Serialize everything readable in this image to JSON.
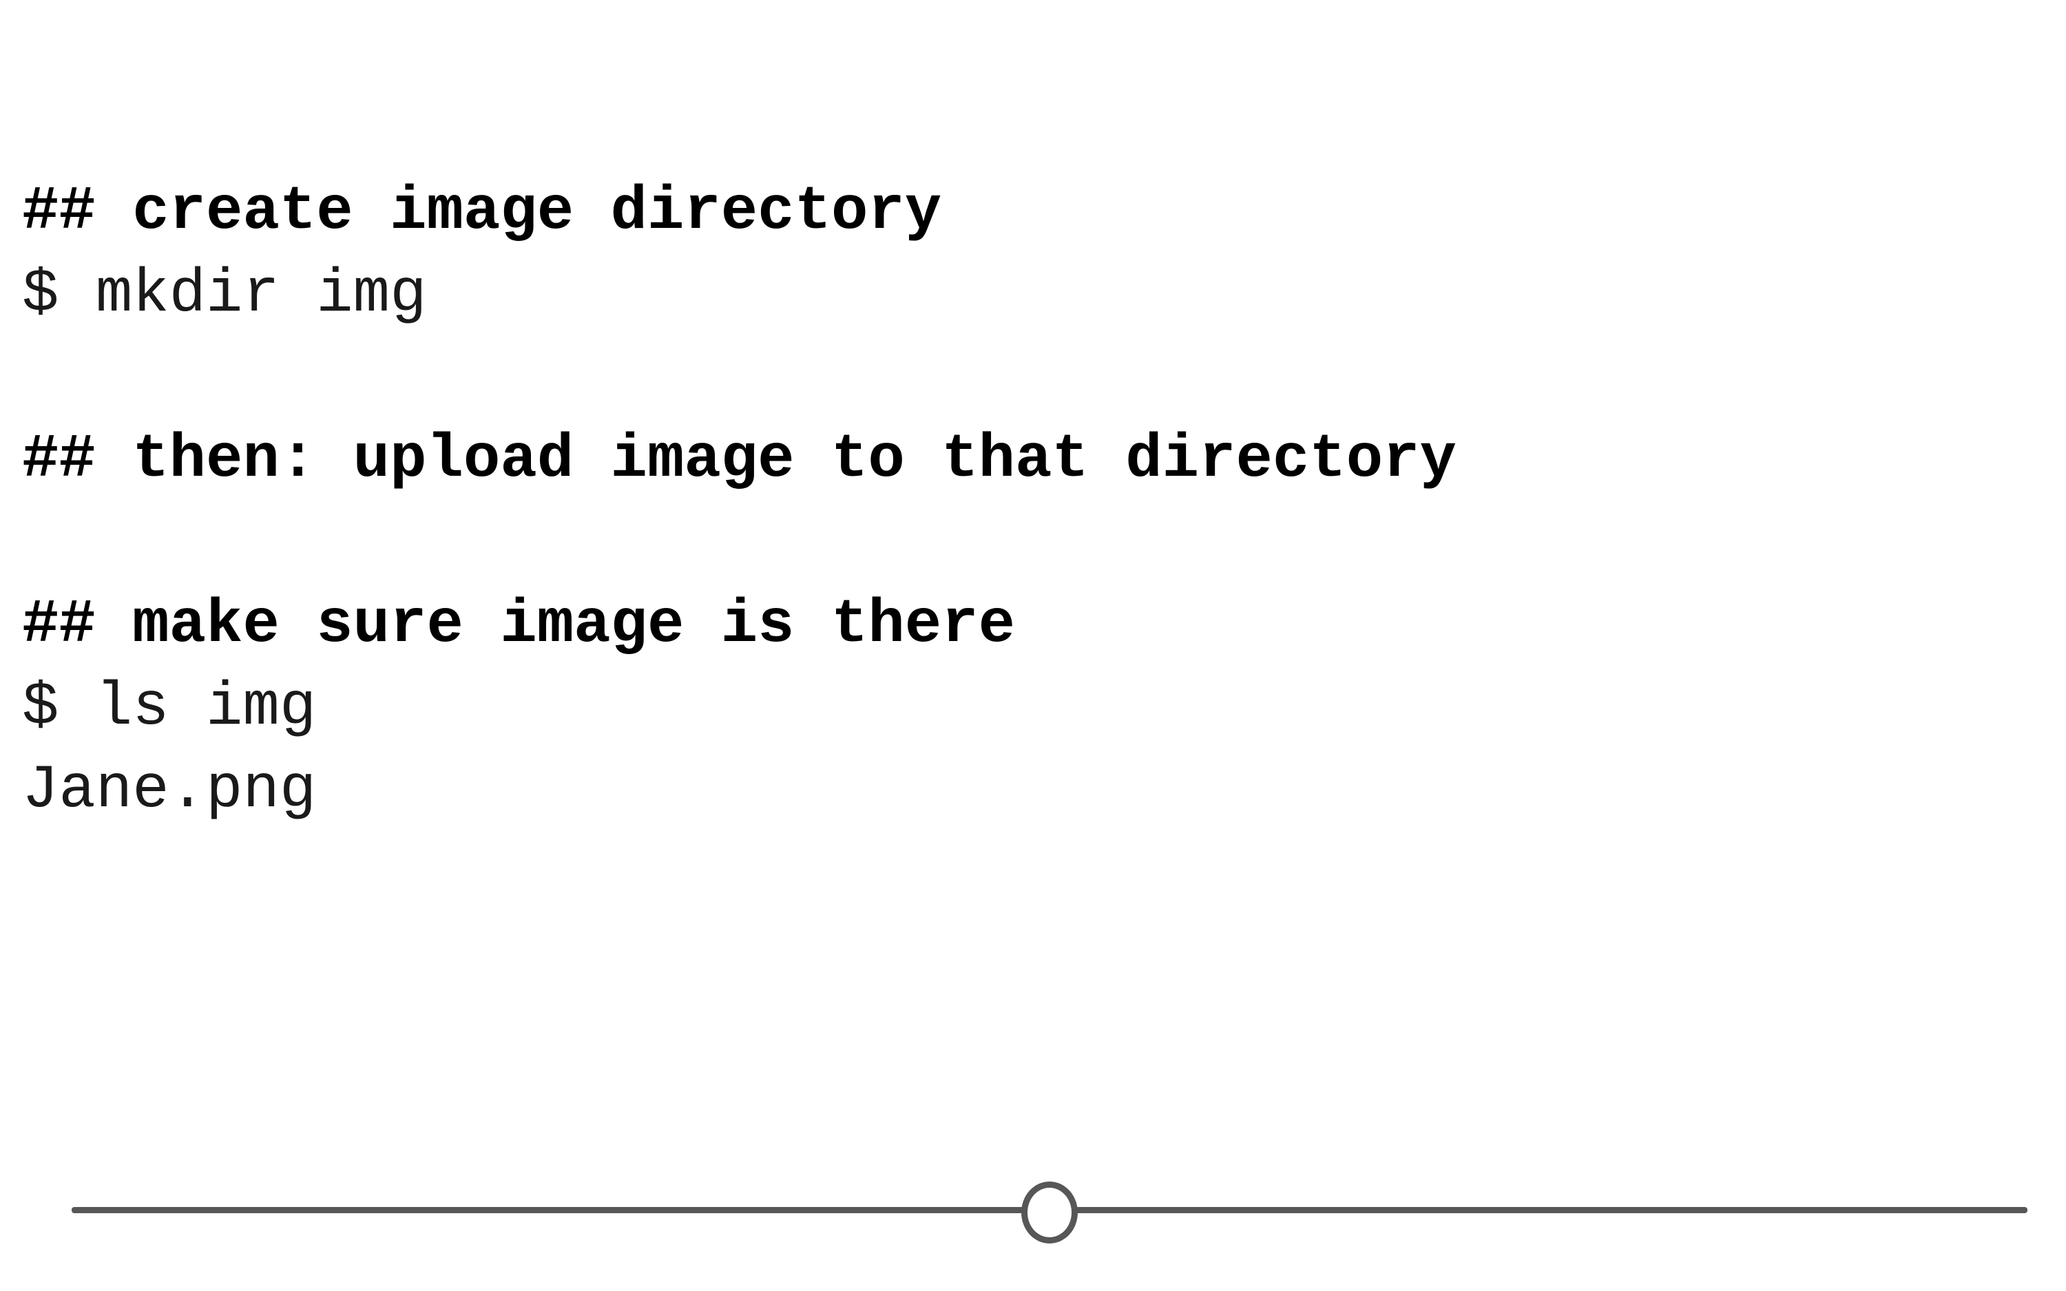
{
  "terminal": {
    "comment_create": "## create image directory",
    "cmd_mkdir": "$ mkdir img",
    "comment_upload": "## then: upload image to that directory",
    "comment_check": "## make sure image is there",
    "cmd_ls": "$ ls img",
    "output_file": "Jane.png"
  },
  "slider": {
    "value_fraction": 0.5,
    "colors": {
      "track": "#575757",
      "thumb_fill": "#ffffff"
    }
  }
}
